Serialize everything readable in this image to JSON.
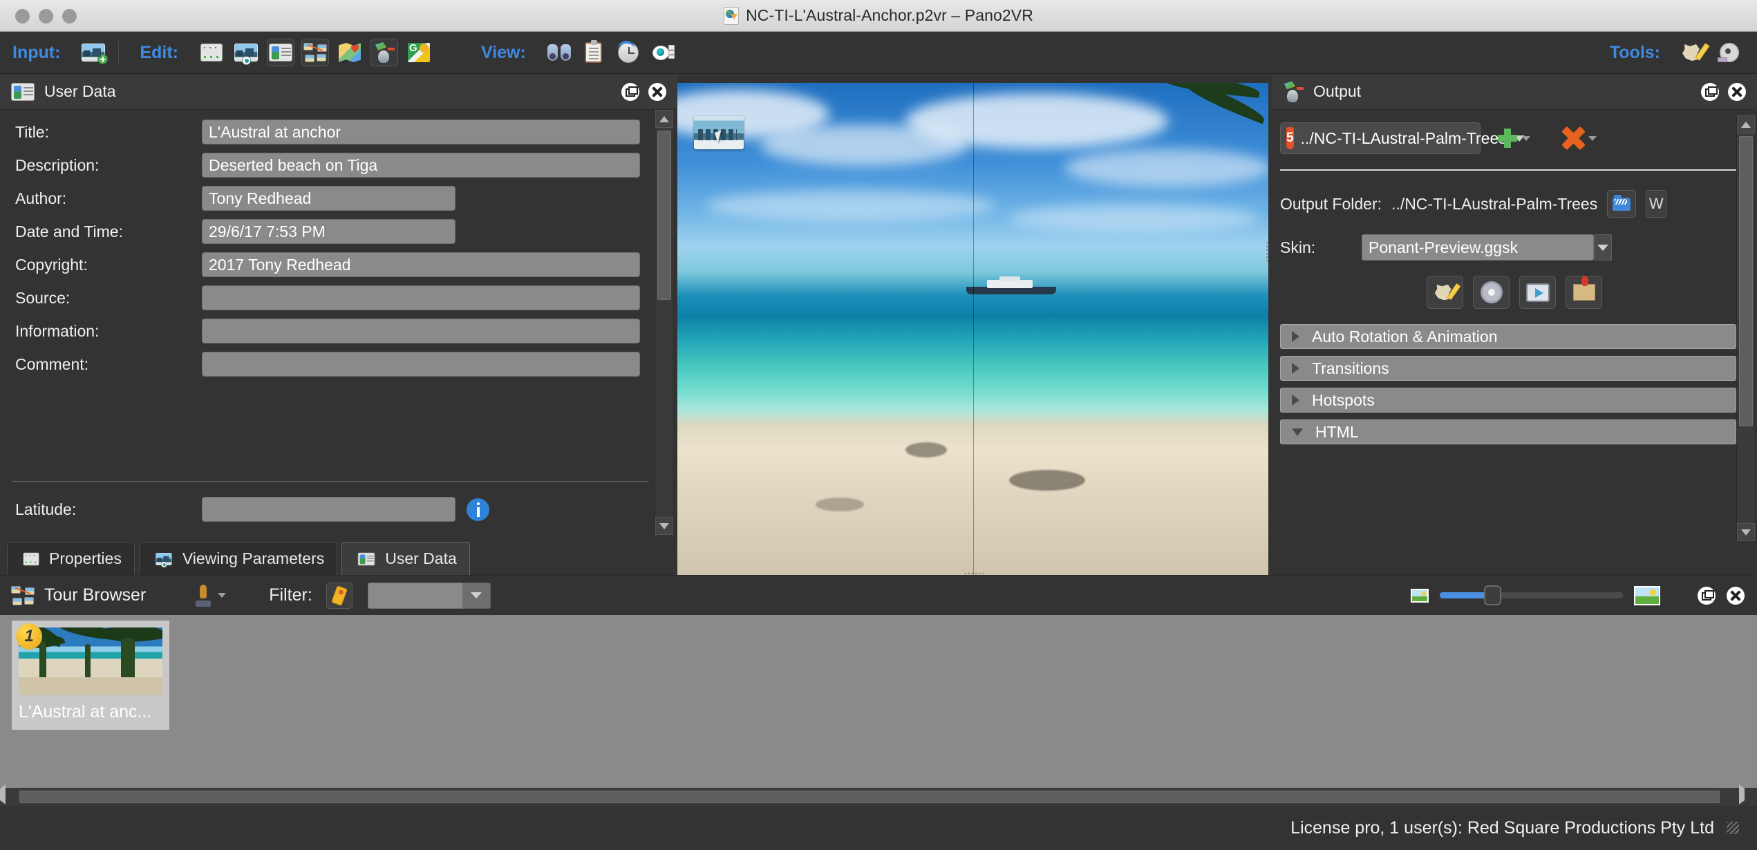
{
  "window": {
    "title": "NC-TI-L'Austral-Anchor.p2vr – Pano2VR",
    "doc_icon": "pano2vr-document-icon"
  },
  "toolbar": {
    "input_label": "Input:",
    "edit_label": "Edit:",
    "view_label": "View:",
    "tools_label": "Tools:",
    "input_buttons": [
      {
        "name": "add-panorama-icon",
        "title": "Add Panorama"
      }
    ],
    "edit_buttons": [
      {
        "name": "properties-mixer-icon",
        "title": "Properties"
      },
      {
        "name": "viewing-parameters-icon",
        "title": "Viewing Parameters"
      },
      {
        "name": "user-data-icon",
        "title": "User Data"
      },
      {
        "name": "tour-browser-icon",
        "title": "Tour Browser"
      },
      {
        "name": "map-icon",
        "title": "Map"
      },
      {
        "name": "output-icon",
        "title": "Output"
      },
      {
        "name": "google-maps-icon",
        "title": "Google Maps"
      }
    ],
    "view_buttons": [
      {
        "name": "binoculars-icon",
        "title": "Viewer"
      },
      {
        "name": "clipboard-icon",
        "title": "Log"
      },
      {
        "name": "history-clock-icon",
        "title": "History"
      },
      {
        "name": "visibility-eye-icon",
        "title": "Visibility"
      }
    ],
    "tools_buttons": [
      {
        "name": "skin-editor-icon",
        "title": "Skin Editor"
      },
      {
        "name": "film-reel-icon",
        "title": "Animation Editor"
      }
    ]
  },
  "user_data_panel": {
    "title": "User Data",
    "panel_icon": "user-data-icon",
    "float_icon": "float-panel-icon",
    "close_icon": "close-panel-icon",
    "fields": [
      {
        "label": "Title:",
        "value": "L'Austral at anchor",
        "width": "long"
      },
      {
        "label": "Description:",
        "value": "Deserted beach on Tiga",
        "width": "long"
      },
      {
        "label": "Author:",
        "value": "Tony Redhead",
        "width": "mid"
      },
      {
        "label": "Date and Time:",
        "value": "29/6/17 7:53 PM",
        "width": "mid"
      },
      {
        "label": "Copyright:",
        "value": "2017 Tony Redhead",
        "width": "long"
      },
      {
        "label": "Source:",
        "value": "",
        "width": "long"
      },
      {
        "label": "Information:",
        "value": "",
        "width": "long"
      },
      {
        "label": "Comment:",
        "value": "",
        "width": "long"
      }
    ],
    "latitude": {
      "label": "Latitude:",
      "value": "",
      "info_icon": "info-icon"
    },
    "tabs": [
      {
        "label": "Properties",
        "icon": "properties-mixer-icon",
        "active": false
      },
      {
        "label": "Viewing Parameters",
        "icon": "viewing-parameters-icon",
        "active": false
      },
      {
        "label": "User Data",
        "icon": "user-data-icon",
        "active": true
      }
    ]
  },
  "output_panel": {
    "title": "Output",
    "panel_icon": "output-icon",
    "float_icon": "float-panel-icon",
    "close_icon": "close-panel-icon",
    "format_selector": {
      "value": "../NC-TI-LAustral-Palm-Trees",
      "icon": "html5-icon",
      "dropdown_icon": "chevron-down-icon"
    },
    "add_button": {
      "name": "add-output-button",
      "icon": "plus-icon"
    },
    "remove_button": {
      "name": "remove-output-button",
      "icon": "x-icon"
    },
    "output_folder": {
      "label": "Output Folder:",
      "value": "../NC-TI-LAustral-Palm-Trees",
      "browse_icon": "folder-icon"
    },
    "skin": {
      "label": "Skin:",
      "value": "Ponant-Preview.ggsk",
      "dropdown_icon": "chevron-down-icon"
    },
    "skin_buttons": [
      {
        "name": "skin-editor-button",
        "icon": "skin-editor-icon"
      },
      {
        "name": "skin-settings-button",
        "icon": "gear-icon"
      },
      {
        "name": "preview-button",
        "icon": "monitor-play-icon"
      },
      {
        "name": "package-button",
        "icon": "package-box-icon"
      }
    ],
    "sections": [
      {
        "label": "Auto Rotation & Animation",
        "expanded": false
      },
      {
        "label": "Transitions",
        "expanded": false
      },
      {
        "label": "Hotspots",
        "expanded": false
      },
      {
        "label": "HTML",
        "expanded": true
      }
    ]
  },
  "viewer": {
    "name": "panorama-viewer",
    "cursor_icon": "panorama-drag-cursor"
  },
  "tour_browser": {
    "title": "Tour Browser",
    "panel_icon": "tour-browser-icon",
    "stamp_icon": "stamp-tool-icon",
    "filter_label": "Filter:",
    "filter_tag_icon": "tag-filter-icon",
    "filter_value": "",
    "filter_dropdown_icon": "chevron-down-icon",
    "zoom_small_icon": "small-thumbnail-icon",
    "zoom_large_icon": "large-thumbnail-icon",
    "zoom_value": 26,
    "float_icon": "float-panel-icon",
    "close_icon": "close-panel-icon",
    "nodes": [
      {
        "number": "1",
        "caption": "L'Austral at anc...",
        "selected": true
      }
    ]
  },
  "status_bar": {
    "license": "License pro, 1 user(s): Red Square Productions Pty Ltd",
    "grip_icon": "resize-grip-icon"
  },
  "colors": {
    "accent_blue": "#3e8ae2",
    "panel_bg": "#333333",
    "field_bg": "#8a8a8a",
    "html5_orange": "#e34f26",
    "remove_orange": "#e8621f",
    "add_green": "#5cb85c"
  }
}
